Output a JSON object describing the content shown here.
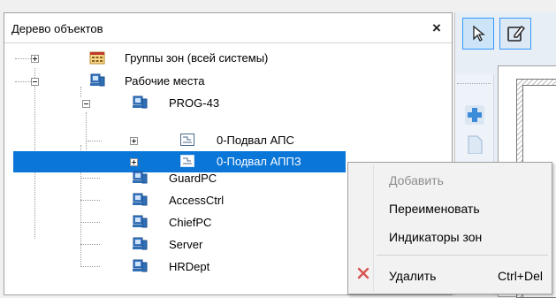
{
  "panel": {
    "title": "Дерево объектов",
    "close_glyph": "×"
  },
  "tree": {
    "items": [
      {
        "label": "Группы зон (всей системы)",
        "icon": "zone-groups-icon",
        "expander": "plus"
      },
      {
        "label": "Рабочие места",
        "icon": "workstation-icon",
        "expander": "minus"
      },
      {
        "label": "PROG-43",
        "icon": "workstation-icon",
        "expander": "minus"
      },
      {
        "label": "0-Подвал АПС",
        "icon": "zone-icon",
        "expander": "plus"
      },
      {
        "label": "0-Подвал АППЗ",
        "icon": "zone-icon",
        "expander": "plus",
        "selected": true
      },
      {
        "label": "GuardPC",
        "icon": "workstation-icon"
      },
      {
        "label": "AccessCtrl",
        "icon": "workstation-icon"
      },
      {
        "label": "ChiefPC",
        "icon": "workstation-icon"
      },
      {
        "label": "Server",
        "icon": "workstation-icon"
      },
      {
        "label": "HRDept",
        "icon": "workstation-icon"
      }
    ]
  },
  "toolbar": {
    "select_tool_icon": "pointer-icon",
    "edit_tool_icon": "edit-icon",
    "add_icon": "add-plus-icon",
    "page_icon": "page-icon"
  },
  "context_menu": {
    "items": [
      {
        "label": "Добавить",
        "disabled": true
      },
      {
        "label": "Переименовать"
      },
      {
        "label": "Индикаторы зон"
      },
      {
        "label": "Удалить",
        "shortcut": "Ctrl+Del",
        "icon": "delete-x-icon"
      }
    ]
  },
  "colors": {
    "selection": "#0a76d8",
    "delete_icon": "#d9534f",
    "icon_blue": "#2f6fb5"
  }
}
